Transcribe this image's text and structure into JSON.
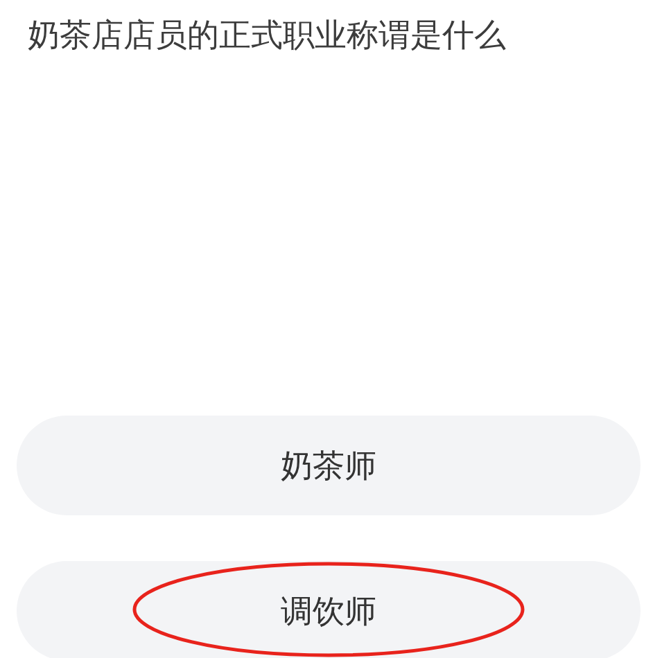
{
  "question": "奶茶店店员的正式职业称谓是什么",
  "options": [
    {
      "label": "奶茶师",
      "circled": false
    },
    {
      "label": "调饮师",
      "circled": true
    }
  ]
}
